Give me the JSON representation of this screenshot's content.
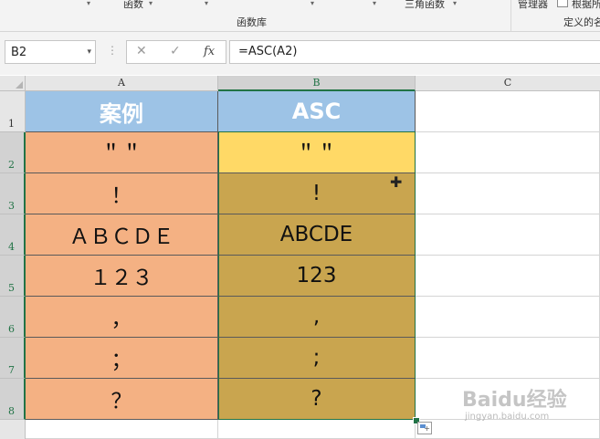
{
  "ribbon": {
    "items": [
      {
        "label": "函数",
        "caret": "▾"
      },
      {
        "label": "三角函数",
        "caret": "▾"
      },
      {
        "label": "管理器"
      },
      {
        "label": "根据所"
      }
    ],
    "groups": [
      {
        "label": "函数库"
      },
      {
        "label": "定义的名"
      }
    ]
  },
  "formula_bar": {
    "name_box": "B2",
    "name_box_dropdown": "▾",
    "separator": "⋮",
    "cancel_glyph": "✕",
    "enter_glyph": "✓",
    "fx_label": "fx",
    "formula": "=ASC(A2)"
  },
  "sheet": {
    "columns": [
      "A",
      "B",
      "C"
    ],
    "rows": [
      "1",
      "2",
      "3",
      "4",
      "5",
      "6",
      "7",
      "8"
    ],
    "header_row": {
      "a": "案例",
      "b": "ASC"
    },
    "data": [
      {
        "a": "＂＂",
        "b": "＂＂"
      },
      {
        "a": "！",
        "b": "!"
      },
      {
        "a": "ＡＢＣＤＥ",
        "b": "ABCDE"
      },
      {
        "a": "１２３",
        "b": "123"
      },
      {
        "a": "，",
        "b": ","
      },
      {
        "a": "；",
        "b": ";"
      },
      {
        "a": "？",
        "b": "?"
      }
    ],
    "active_cell": "B2"
  },
  "colors": {
    "header_fill": "#9dc3e6",
    "col_a_fill": "#f4b183",
    "col_b_fill": "#c9a54f",
    "active_cell_fill": "#ffd966",
    "selection_border": "#217346"
  },
  "watermark": {
    "text": "Baidu经验",
    "url_text": "jingyan.baidu.com"
  }
}
